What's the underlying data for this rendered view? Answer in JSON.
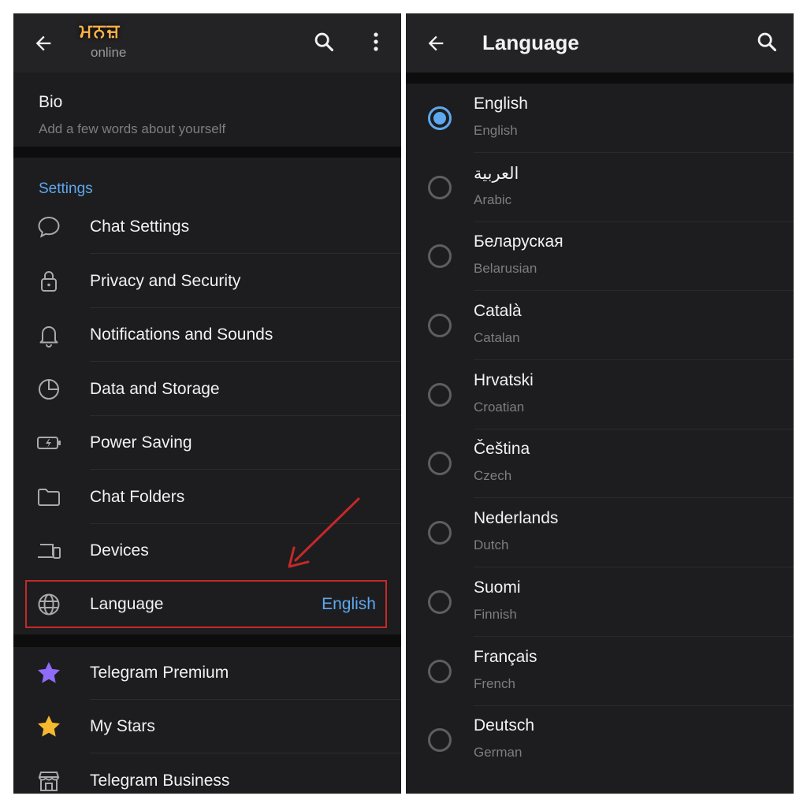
{
  "left_panel": {
    "header": {
      "name_text": "ਮਨਜ਼",
      "status": "online",
      "icons": [
        "back-arrow-icon",
        "search-icon",
        "more-vertical-icon"
      ]
    },
    "bio": {
      "title": "Bio",
      "placeholder": "Add a few words about yourself"
    },
    "settings_header": "Settings",
    "settings_items": [
      {
        "label": "Chat Settings",
        "icon": "chat-bubble-icon"
      },
      {
        "label": "Privacy and Security",
        "icon": "lock-icon"
      },
      {
        "label": "Notifications and Sounds",
        "icon": "bell-icon"
      },
      {
        "label": "Data and Storage",
        "icon": "pie-chart-icon"
      },
      {
        "label": "Power Saving",
        "icon": "battery-icon"
      },
      {
        "label": "Chat Folders",
        "icon": "folder-icon"
      },
      {
        "label": "Devices",
        "icon": "devices-icon"
      },
      {
        "label": "Language",
        "icon": "globe-icon",
        "value": "English"
      }
    ],
    "extra_items": [
      {
        "label": "Telegram Premium",
        "icon": "purple-star-icon"
      },
      {
        "label": "My Stars",
        "icon": "gold-star-icon"
      },
      {
        "label": "Telegram Business",
        "icon": "store-icon"
      }
    ]
  },
  "right_panel": {
    "title": "Language",
    "languages": [
      {
        "native": "English",
        "english": "English",
        "selected": true
      },
      {
        "native": "العربية",
        "english": "Arabic",
        "selected": false
      },
      {
        "native": "Беларуская",
        "english": "Belarusian",
        "selected": false
      },
      {
        "native": "Català",
        "english": "Catalan",
        "selected": false
      },
      {
        "native": "Hrvatski",
        "english": "Croatian",
        "selected": false
      },
      {
        "native": "Čeština",
        "english": "Czech",
        "selected": false
      },
      {
        "native": "Nederlands",
        "english": "Dutch",
        "selected": false
      },
      {
        "native": "Suomi",
        "english": "Finnish",
        "selected": false
      },
      {
        "native": "Français",
        "english": "French",
        "selected": false
      },
      {
        "native": "Deutsch",
        "english": "German",
        "selected": false
      }
    ]
  },
  "colors": {
    "background": "#1d1d1f",
    "accent_blue": "#5ea8ee",
    "highlight_red": "#c62828",
    "premium_purple": "#8e6cf7",
    "stars_gold": "#f5b82e"
  }
}
